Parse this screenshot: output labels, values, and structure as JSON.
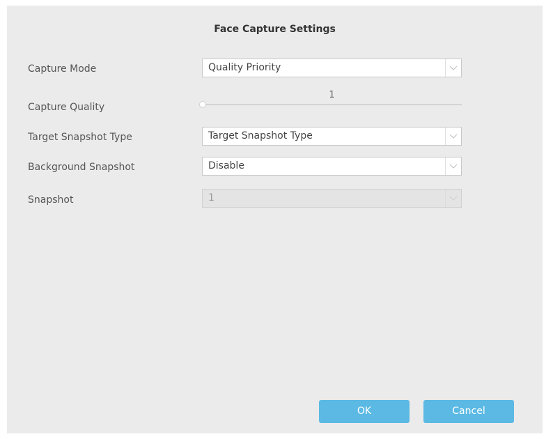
{
  "dialog": {
    "title": "Face Capture Settings"
  },
  "fields": {
    "capture_mode": {
      "label": "Capture Mode",
      "value": "Quality Priority"
    },
    "capture_quality": {
      "label": "Capture Quality",
      "value": "1"
    },
    "target_snapshot_type": {
      "label": "Target Snapshot Type",
      "value": "Target Snapshot Type"
    },
    "background_snapshot": {
      "label": "Background Snapshot",
      "value": "Disable"
    },
    "snapshot": {
      "label": "Snapshot",
      "value": "1"
    }
  },
  "buttons": {
    "ok": "OK",
    "cancel": "Cancel"
  },
  "colors": {
    "accent": "#5bb9e4",
    "dialog_bg": "#ebebeb"
  },
  "icons": {
    "dropdown": "chevron-down-icon"
  }
}
